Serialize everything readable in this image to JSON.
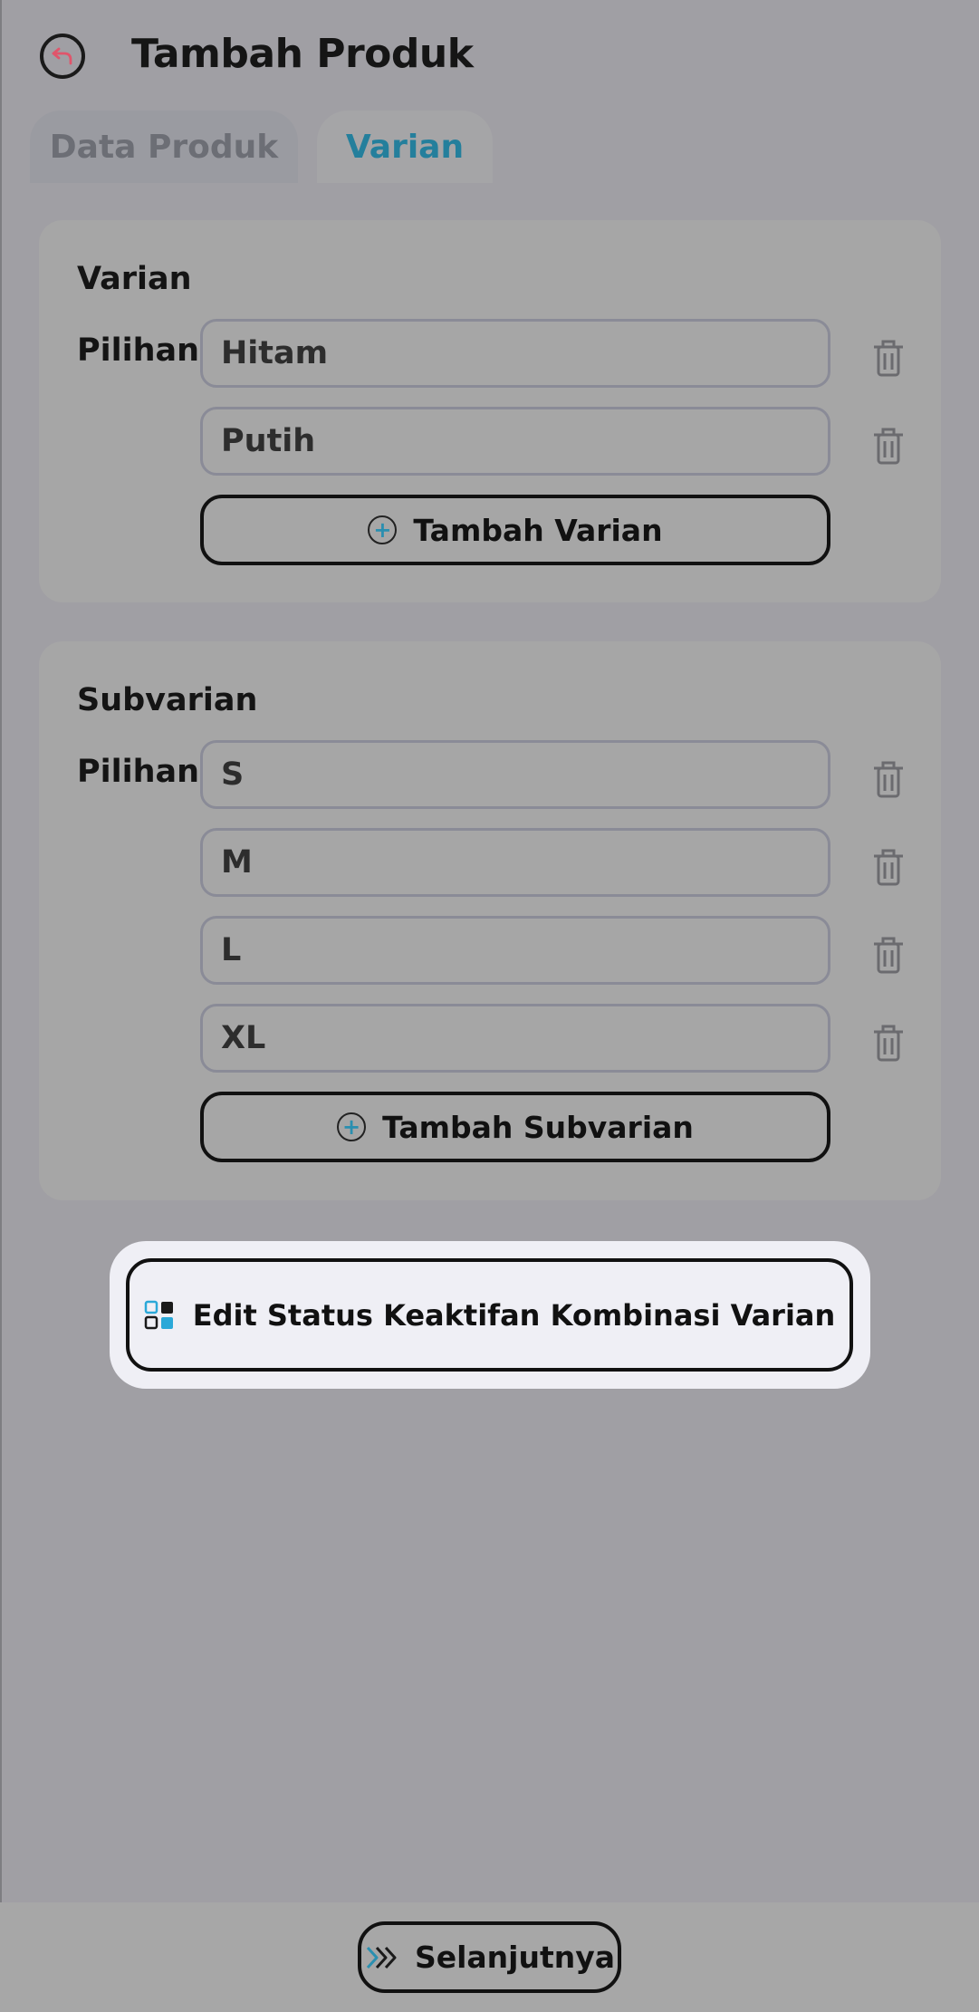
{
  "header": {
    "title": "Tambah Produk",
    "back_icon": "undo-arrow-icon"
  },
  "tabs": [
    {
      "label": "Data Produk",
      "active": false
    },
    {
      "label": "Varian",
      "active": true
    }
  ],
  "varian": {
    "title": "Varian",
    "row_label": "Pilihan",
    "options": [
      "Hitam",
      "Putih"
    ],
    "add_label": "Tambah Varian"
  },
  "subvarian": {
    "title": "Subvarian",
    "row_label": "Pilihan",
    "options": [
      "S",
      "M",
      "L",
      "XL"
    ],
    "add_label": "Tambah Subvarian"
  },
  "edit_status_label": "Edit Status Keaktifan Kombinasi Varian",
  "next_label": "Selanjutnya",
  "colors": {
    "accent": "#247f9c",
    "icon_blue": "#2aa8d8",
    "danger_icon": "#e0556b"
  }
}
